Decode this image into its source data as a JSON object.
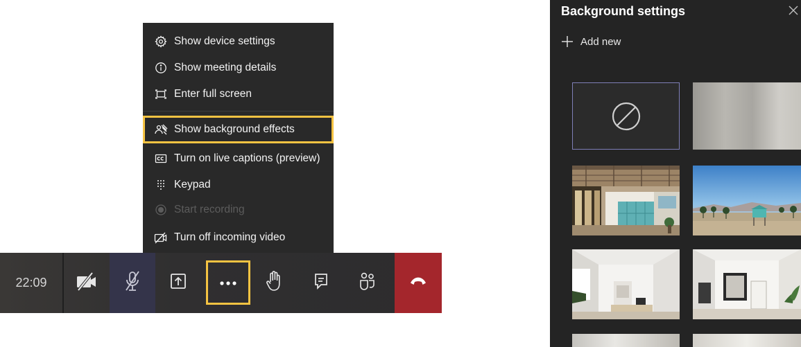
{
  "menu": {
    "items": [
      {
        "label": "Show device settings",
        "icon": "gear-icon",
        "state": "normal"
      },
      {
        "label": "Show meeting details",
        "icon": "info-icon",
        "state": "normal"
      },
      {
        "label": "Enter full screen",
        "icon": "fullscreen-icon",
        "state": "normal"
      },
      {
        "label": "Show background effects",
        "icon": "background-effects-icon",
        "state": "highlighted"
      },
      {
        "label": "Turn on live captions (preview)",
        "icon": "captions-icon",
        "state": "normal"
      },
      {
        "label": "Keypad",
        "icon": "keypad-icon",
        "state": "normal"
      },
      {
        "label": "Start recording",
        "icon": "record-icon",
        "state": "disabled"
      },
      {
        "label": "Turn off incoming video",
        "icon": "video-off-icon",
        "state": "normal"
      }
    ]
  },
  "control_bar": {
    "timer": "22:09",
    "buttons": [
      "camera-off-icon",
      "mic-off-icon",
      "share-screen-icon",
      "more-actions-icon",
      "raise-hand-icon",
      "chat-icon",
      "participants-icon",
      "hang-up-icon"
    ],
    "colors": {
      "background": "#2d2c2e",
      "mic_active": "#34344a",
      "hang_up": "#a4262c",
      "highlight": "#f5c342"
    }
  },
  "background_panel": {
    "title": "Background settings",
    "add_new": "Add new",
    "tiles": [
      "none",
      "blur",
      "office-loft",
      "beach",
      "white-room",
      "white-room-mirror",
      "partial-1",
      "partial-2"
    ],
    "selected_tile": "none"
  }
}
